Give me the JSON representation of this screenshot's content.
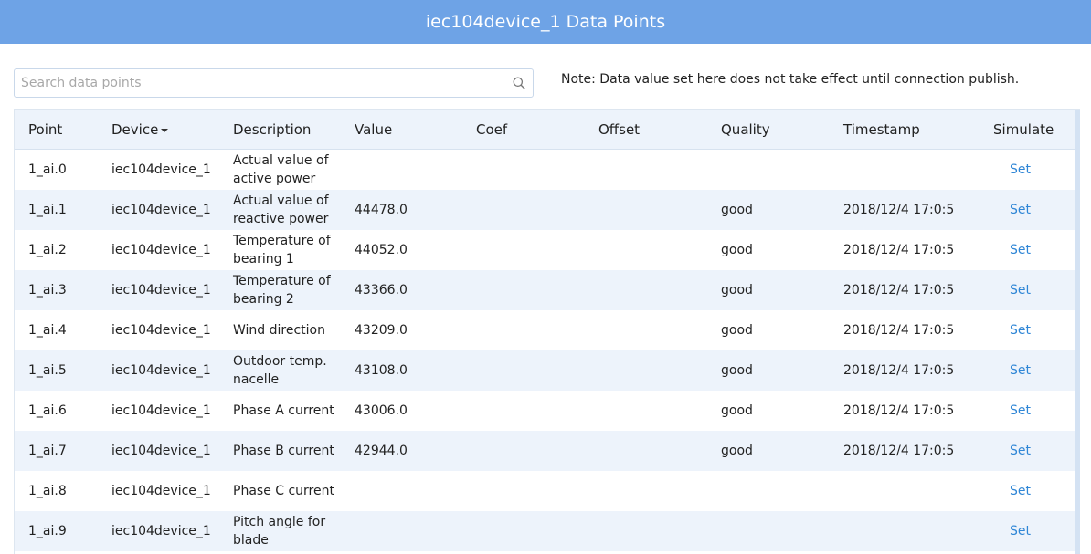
{
  "header": {
    "title": "iec104device_1 Data Points"
  },
  "search": {
    "placeholder": "Search data points"
  },
  "note": "Note: Data value set here does not take effect until connection publish.",
  "table": {
    "columns": {
      "point": "Point",
      "device": "Device",
      "description": "Description",
      "value": "Value",
      "coef": "Coef",
      "offset": "Offset",
      "quality": "Quality",
      "timestamp": "Timestamp",
      "simulate": "Simulate"
    },
    "rows": [
      {
        "point": "1_ai.0",
        "device": "iec104device_1",
        "description": "Actual value of active power",
        "value": "",
        "coef": "",
        "offset": "",
        "quality": "",
        "timestamp": "",
        "action": "Set"
      },
      {
        "point": "1_ai.1",
        "device": "iec104device_1",
        "description": "Actual value of reactive power",
        "value": "44478.0",
        "coef": "",
        "offset": "",
        "quality": "good",
        "timestamp": "2018/12/4 17:0:5",
        "action": "Set"
      },
      {
        "point": "1_ai.2",
        "device": "iec104device_1",
        "description": "Temperature of bearing 1",
        "value": "44052.0",
        "coef": "",
        "offset": "",
        "quality": "good",
        "timestamp": "2018/12/4 17:0:5",
        "action": "Set"
      },
      {
        "point": "1_ai.3",
        "device": "iec104device_1",
        "description": "Temperature of bearing 2",
        "value": "43366.0",
        "coef": "",
        "offset": "",
        "quality": "good",
        "timestamp": "2018/12/4 17:0:5",
        "action": "Set"
      },
      {
        "point": "1_ai.4",
        "device": "iec104device_1",
        "description": "Wind direction",
        "value": "43209.0",
        "coef": "",
        "offset": "",
        "quality": "good",
        "timestamp": "2018/12/4 17:0:5",
        "action": "Set"
      },
      {
        "point": "1_ai.5",
        "device": "iec104device_1",
        "description": "Outdoor temp. nacelle",
        "value": "43108.0",
        "coef": "",
        "offset": "",
        "quality": "good",
        "timestamp": "2018/12/4 17:0:5",
        "action": "Set"
      },
      {
        "point": "1_ai.6",
        "device": "iec104device_1",
        "description": "Phase A current",
        "value": "43006.0",
        "coef": "",
        "offset": "",
        "quality": "good",
        "timestamp": "2018/12/4 17:0:5",
        "action": "Set"
      },
      {
        "point": "1_ai.7",
        "device": "iec104device_1",
        "description": "Phase B current",
        "value": "42944.0",
        "coef": "",
        "offset": "",
        "quality": "good",
        "timestamp": "2018/12/4 17:0:5",
        "action": "Set"
      },
      {
        "point": "1_ai.8",
        "device": "iec104device_1",
        "description": "Phase C current",
        "value": "",
        "coef": "",
        "offset": "",
        "quality": "",
        "timestamp": "",
        "action": "Set"
      },
      {
        "point": "1_ai.9",
        "device": "iec104device_1",
        "description": "Pitch angle for blade",
        "value": "",
        "coef": "",
        "offset": "",
        "quality": "",
        "timestamp": "",
        "action": "Set"
      }
    ]
  },
  "icons": {
    "search": "search-icon",
    "sort": "caret-down-icon"
  },
  "colors": {
    "header_bg": "#6ea3e6",
    "row_alt": "#edf3fb",
    "link": "#2f86d6"
  }
}
